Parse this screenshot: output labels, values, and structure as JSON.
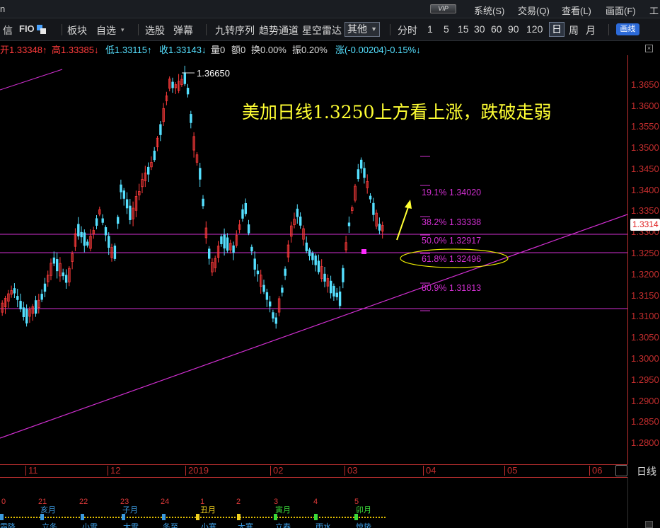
{
  "window": {
    "title_fragment": "n",
    "vip_badge": "VIP",
    "menu": [
      "系统(S)",
      "交易(Q)",
      "查看(L)",
      "画面(F)",
      "工"
    ]
  },
  "toolbar": {
    "left_fragment": "信",
    "fio_label": "FIO",
    "items": [
      "板块",
      "自选",
      "选股",
      "弹幕",
      "九转序列",
      "趋势通道",
      "星空雷达"
    ],
    "dropdown_value": "其他",
    "periods": [
      "分时",
      "1",
      "5",
      "15",
      "30",
      "60",
      "90",
      "120",
      "日",
      "周",
      "月"
    ],
    "active_period": "日",
    "draw_button": "画线"
  },
  "quote": {
    "open": "开1.33348↑",
    "high": "高1.33385↓",
    "low": "低1.33115↑",
    "close": "收1.33143↓",
    "volume": "量0",
    "amount": "额0",
    "turnover": "换0.00%",
    "amplitude": "振0.20%",
    "change": "涨(-0.00204)-0.15%↓"
  },
  "chart": {
    "annotation": "美加日线1.3250上方看上涨，跌破走弱",
    "high_label": "1.36650",
    "current_price": "1.3314",
    "fib_levels": [
      {
        "label": "19.1%  1.34020",
        "value": 1.3402
      },
      {
        "label": "38.2%  1.33338",
        "value": 1.33338
      },
      {
        "label": "50.0%  1.32917",
        "value": 1.32917
      },
      {
        "label": "61.8%  1.32496",
        "value": 1.32496
      },
      {
        "label": "80.9%  1.31813",
        "value": 1.31813
      }
    ],
    "colors": {
      "up": "#ff3b3b",
      "down": "#55e0ff",
      "line": "#d22fd2",
      "text": "#ffff33",
      "axis": "#c22d2d"
    }
  },
  "chart_data": {
    "type": "candlestick",
    "title": "美加日线1.3250上方看上涨，跌破走弱",
    "ylim": [
      1.275,
      1.372
    ],
    "y_ticks": [
      "1.3650",
      "1.3600",
      "1.3550",
      "1.3500",
      "1.3450",
      "1.3400",
      "1.3350",
      "1.3300",
      "1.3250",
      "1.3200",
      "1.3150",
      "1.3100",
      "1.3050",
      "1.3000",
      "1.2950",
      "1.2900",
      "1.2850",
      "1.2800"
    ],
    "x_ticks": [
      "11",
      "12",
      "2019",
      "02",
      "03",
      "04",
      "05",
      "06"
    ],
    "period_label": "日线",
    "horizontal_lines": [
      1.3303,
      1.3258,
      1.3122
    ],
    "fib_levels": [
      1.3402,
      1.33338,
      1.32917,
      1.32496,
      1.31813
    ]
  },
  "lunar": {
    "numbers": [
      "0",
      "21",
      "22",
      "23",
      "24",
      "1",
      "2",
      "3",
      "4",
      "5"
    ],
    "months": [
      "亥月",
      "子月",
      "丑月",
      "寅月",
      "卯月"
    ],
    "terms": [
      "霜降",
      "立冬",
      "小雪",
      "大雪",
      "冬至",
      "小寒",
      "大寒",
      "立春",
      "雨水",
      "惊蛰"
    ]
  }
}
